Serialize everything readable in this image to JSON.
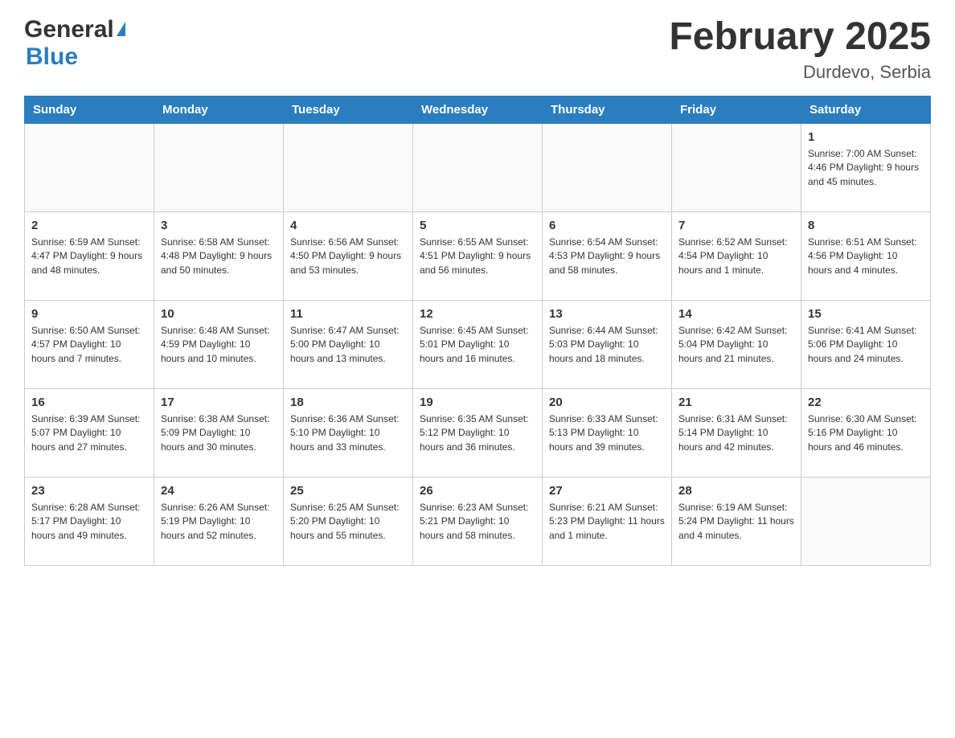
{
  "header": {
    "logo_general": "General",
    "logo_blue": "Blue",
    "month_title": "February 2025",
    "location": "Durdevo, Serbia"
  },
  "days_of_week": [
    "Sunday",
    "Monday",
    "Tuesday",
    "Wednesday",
    "Thursday",
    "Friday",
    "Saturday"
  ],
  "weeks": [
    [
      {
        "day": "",
        "info": ""
      },
      {
        "day": "",
        "info": ""
      },
      {
        "day": "",
        "info": ""
      },
      {
        "day": "",
        "info": ""
      },
      {
        "day": "",
        "info": ""
      },
      {
        "day": "",
        "info": ""
      },
      {
        "day": "1",
        "info": "Sunrise: 7:00 AM\nSunset: 4:46 PM\nDaylight: 9 hours\nand 45 minutes."
      }
    ],
    [
      {
        "day": "2",
        "info": "Sunrise: 6:59 AM\nSunset: 4:47 PM\nDaylight: 9 hours\nand 48 minutes."
      },
      {
        "day": "3",
        "info": "Sunrise: 6:58 AM\nSunset: 4:48 PM\nDaylight: 9 hours\nand 50 minutes."
      },
      {
        "day": "4",
        "info": "Sunrise: 6:56 AM\nSunset: 4:50 PM\nDaylight: 9 hours\nand 53 minutes."
      },
      {
        "day": "5",
        "info": "Sunrise: 6:55 AM\nSunset: 4:51 PM\nDaylight: 9 hours\nand 56 minutes."
      },
      {
        "day": "6",
        "info": "Sunrise: 6:54 AM\nSunset: 4:53 PM\nDaylight: 9 hours\nand 58 minutes."
      },
      {
        "day": "7",
        "info": "Sunrise: 6:52 AM\nSunset: 4:54 PM\nDaylight: 10 hours\nand 1 minute."
      },
      {
        "day": "8",
        "info": "Sunrise: 6:51 AM\nSunset: 4:56 PM\nDaylight: 10 hours\nand 4 minutes."
      }
    ],
    [
      {
        "day": "9",
        "info": "Sunrise: 6:50 AM\nSunset: 4:57 PM\nDaylight: 10 hours\nand 7 minutes."
      },
      {
        "day": "10",
        "info": "Sunrise: 6:48 AM\nSunset: 4:59 PM\nDaylight: 10 hours\nand 10 minutes."
      },
      {
        "day": "11",
        "info": "Sunrise: 6:47 AM\nSunset: 5:00 PM\nDaylight: 10 hours\nand 13 minutes."
      },
      {
        "day": "12",
        "info": "Sunrise: 6:45 AM\nSunset: 5:01 PM\nDaylight: 10 hours\nand 16 minutes."
      },
      {
        "day": "13",
        "info": "Sunrise: 6:44 AM\nSunset: 5:03 PM\nDaylight: 10 hours\nand 18 minutes."
      },
      {
        "day": "14",
        "info": "Sunrise: 6:42 AM\nSunset: 5:04 PM\nDaylight: 10 hours\nand 21 minutes."
      },
      {
        "day": "15",
        "info": "Sunrise: 6:41 AM\nSunset: 5:06 PM\nDaylight: 10 hours\nand 24 minutes."
      }
    ],
    [
      {
        "day": "16",
        "info": "Sunrise: 6:39 AM\nSunset: 5:07 PM\nDaylight: 10 hours\nand 27 minutes."
      },
      {
        "day": "17",
        "info": "Sunrise: 6:38 AM\nSunset: 5:09 PM\nDaylight: 10 hours\nand 30 minutes."
      },
      {
        "day": "18",
        "info": "Sunrise: 6:36 AM\nSunset: 5:10 PM\nDaylight: 10 hours\nand 33 minutes."
      },
      {
        "day": "19",
        "info": "Sunrise: 6:35 AM\nSunset: 5:12 PM\nDaylight: 10 hours\nand 36 minutes."
      },
      {
        "day": "20",
        "info": "Sunrise: 6:33 AM\nSunset: 5:13 PM\nDaylight: 10 hours\nand 39 minutes."
      },
      {
        "day": "21",
        "info": "Sunrise: 6:31 AM\nSunset: 5:14 PM\nDaylight: 10 hours\nand 42 minutes."
      },
      {
        "day": "22",
        "info": "Sunrise: 6:30 AM\nSunset: 5:16 PM\nDaylight: 10 hours\nand 46 minutes."
      }
    ],
    [
      {
        "day": "23",
        "info": "Sunrise: 6:28 AM\nSunset: 5:17 PM\nDaylight: 10 hours\nand 49 minutes."
      },
      {
        "day": "24",
        "info": "Sunrise: 6:26 AM\nSunset: 5:19 PM\nDaylight: 10 hours\nand 52 minutes."
      },
      {
        "day": "25",
        "info": "Sunrise: 6:25 AM\nSunset: 5:20 PM\nDaylight: 10 hours\nand 55 minutes."
      },
      {
        "day": "26",
        "info": "Sunrise: 6:23 AM\nSunset: 5:21 PM\nDaylight: 10 hours\nand 58 minutes."
      },
      {
        "day": "27",
        "info": "Sunrise: 6:21 AM\nSunset: 5:23 PM\nDaylight: 11 hours\nand 1 minute."
      },
      {
        "day": "28",
        "info": "Sunrise: 6:19 AM\nSunset: 5:24 PM\nDaylight: 11 hours\nand 4 minutes."
      },
      {
        "day": "",
        "info": ""
      }
    ]
  ]
}
